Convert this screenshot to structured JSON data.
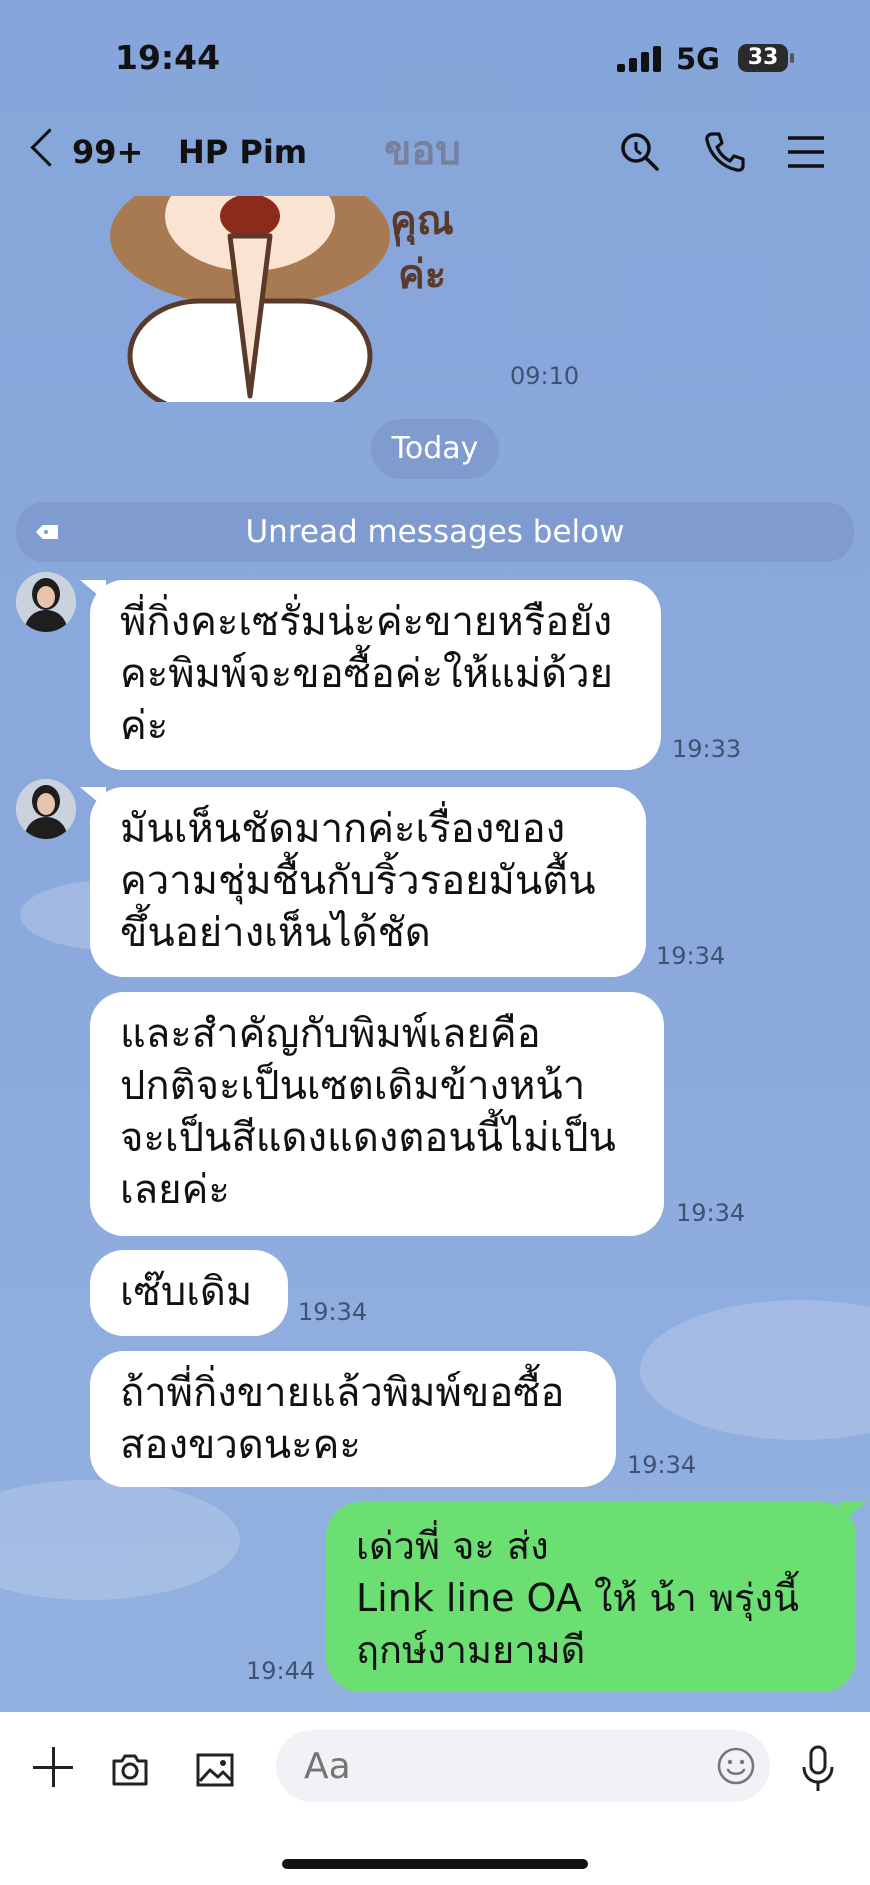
{
  "status_bar": {
    "time": "19:44",
    "network": "5G",
    "battery": "33"
  },
  "header": {
    "back_count": "99+",
    "title": "HP Pim"
  },
  "sticker": {
    "text_lines": [
      "ขอบ",
      "คุณ",
      "ค่ะ"
    ],
    "time": "09:10"
  },
  "date_divider": "Today",
  "unread_label": "Unread messages below",
  "messages": [
    {
      "text": "พี่กิ่งคะเซรั่มน่ะค่ะขายหรือยัง\nคะพิมพ์จะขอซื้อค่ะให้แม่ด้วย\nค่ะ",
      "time": "19:33"
    },
    {
      "text": "มันเห็นชัดมากค่ะเรื่องของ\nความชุ่มชื้นกับริ้วรอยมันตื้น\nขึ้นอย่างเห็นได้ชัด",
      "time": "19:34"
    },
    {
      "text": "และสำคัญกับพิมพ์เลยคือ\nปกติจะเป็นเซตเดิมข้างหน้า\nจะเป็นสีแดงแดงตอนนี้ไม่เป็น\nเลยค่ะ",
      "time": "19:34"
    },
    {
      "text": "เซ๊บเดิม",
      "time": "19:34"
    },
    {
      "text": "ถ้าพี่กิ่งขายแล้วพิมพ์ขอซื้อ\nสองขวดนะคะ",
      "time": "19:34"
    }
  ],
  "my_message": {
    "text": "เด่วพี่ จะ ส่ง\nLink line OA ให้ น้า พรุ่งนี้\nฤกษ์งามยามดี",
    "time": "19:44"
  },
  "input": {
    "placeholder": "Aa"
  },
  "colors": {
    "chat_bg": "#8aa7d9",
    "my_bubble": "#6bdf71",
    "pill": "#7f9bcf"
  }
}
